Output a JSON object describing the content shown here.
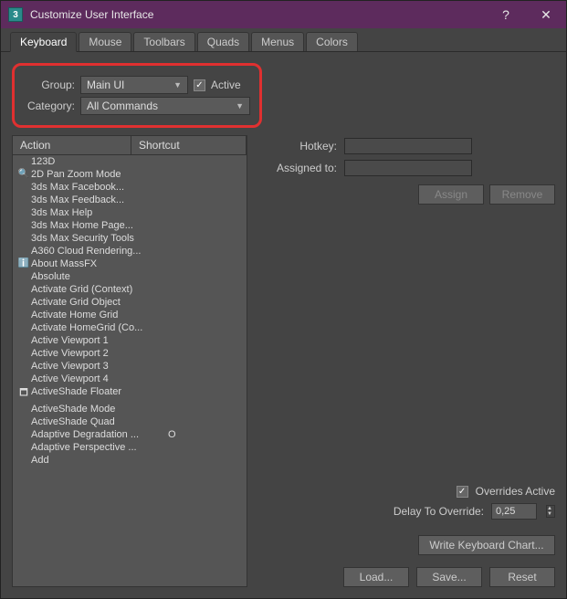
{
  "window": {
    "title": "Customize User Interface"
  },
  "tabs": [
    "Keyboard",
    "Mouse",
    "Toolbars",
    "Quads",
    "Menus",
    "Colors"
  ],
  "group": {
    "label": "Group:",
    "value": "Main UI",
    "activeLabel": "Active"
  },
  "category": {
    "label": "Category:",
    "value": "All Commands"
  },
  "columns": {
    "action": "Action",
    "shortcut": "Shortcut"
  },
  "actions": [
    {
      "label": "123D"
    },
    {
      "icon": "🔍",
      "label": "2D Pan Zoom Mode"
    },
    {
      "label": "3ds Max Facebook..."
    },
    {
      "label": "3ds Max Feedback..."
    },
    {
      "label": "3ds Max Help"
    },
    {
      "label": "3ds Max Home Page..."
    },
    {
      "label": "3ds Max Security Tools"
    },
    {
      "label": "A360 Cloud Rendering..."
    },
    {
      "icon": "ℹ️",
      "label": "About MassFX"
    },
    {
      "label": "Absolute"
    },
    {
      "label": "Activate Grid (Context)"
    },
    {
      "label": "Activate Grid Object"
    },
    {
      "label": "Activate Home Grid"
    },
    {
      "label": "Activate HomeGrid (Co..."
    },
    {
      "label": "Active Viewport 1"
    },
    {
      "label": "Active Viewport 2"
    },
    {
      "label": "Active Viewport 3"
    },
    {
      "label": "Active Viewport 4"
    },
    {
      "icon": "🗖",
      "label": "ActiveShade Floater"
    },
    {
      "label": "ActiveShade Mode"
    },
    {
      "label": "ActiveShade Quad"
    },
    {
      "label": "Adaptive Degradation ...",
      "shortcut": "O"
    },
    {
      "label": "Adaptive Perspective ..."
    },
    {
      "label": "Add"
    }
  ],
  "right": {
    "hotkeyLabel": "Hotkey:",
    "assignedLabel": "Assigned to:",
    "assignBtn": "Assign",
    "removeBtn": "Remove",
    "overridesLabel": "Overrides Active",
    "delayLabel": "Delay To Override:",
    "delayValue": "0,25",
    "writeChartBtn": "Write Keyboard Chart..."
  },
  "bottom": {
    "load": "Load...",
    "save": "Save...",
    "reset": "Reset"
  }
}
